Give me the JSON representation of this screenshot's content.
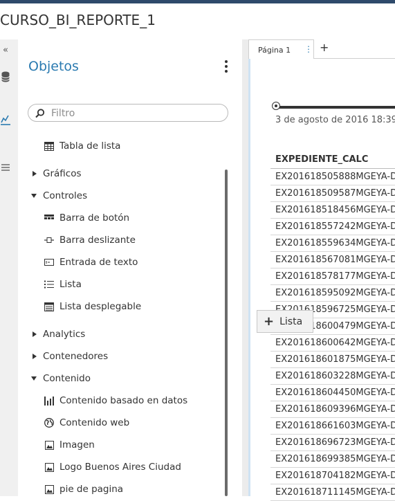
{
  "report": {
    "title": "CURSO_BI_REPORTE_1"
  },
  "rail": {
    "collapse_glyph": "«",
    "icons": [
      "database-icon",
      "chart-icon",
      "list-icon"
    ]
  },
  "objects_panel": {
    "title": "Objetos",
    "filter_placeholder": "Filtro",
    "top_item": {
      "label": "Tabla de lista",
      "icon": "table-icon"
    },
    "groups": [
      {
        "label": "Gráficos",
        "expanded": false
      },
      {
        "label": "Controles",
        "expanded": true,
        "items": [
          {
            "label": "Barra de botón",
            "icon": "button-bar-icon"
          },
          {
            "label": "Barra deslizante",
            "icon": "slider-icon"
          },
          {
            "label": "Entrada de texto",
            "icon": "text-input-icon"
          },
          {
            "label": "Lista",
            "icon": "list-icon"
          },
          {
            "label": "Lista desplegable",
            "icon": "dropdown-list-icon"
          }
        ]
      },
      {
        "label": "Analytics",
        "expanded": false
      },
      {
        "label": "Contenedores",
        "expanded": false
      },
      {
        "label": "Contenido",
        "expanded": true,
        "items": [
          {
            "label": "Contenido basado en datos",
            "icon": "data-driven-content-icon"
          },
          {
            "label": "Contenido web",
            "icon": "globe-icon"
          },
          {
            "label": "Imagen",
            "icon": "image-icon"
          },
          {
            "label": "Logo Buenos Aires Ciudad",
            "icon": "image-icon"
          },
          {
            "label": "pie de pagina",
            "icon": "image-icon"
          }
        ]
      }
    ]
  },
  "canvas": {
    "tab_label": "Página 1",
    "tab_menu_glyph": "⋮",
    "add_tab_glyph": "+",
    "slider_label": "3 de agosto de 2016 18:39",
    "table": {
      "header": "EXPEDIENTE_CALC",
      "rows": [
        "EX201618505888MGEYA-D",
        "EX201618509587MGEYA-D",
        "EX201618518456MGEYA-D",
        "EX201618557242MGEYA-D",
        "EX201618559634MGEYA-D",
        "EX201618567081MGEYA-D",
        "EX201618578177MGEYA-D",
        "EX201618595092MGEYA-D",
        "EX201618596725MGEYA-D",
        "EX201618600479MGEYA-D",
        "EX201618600642MGEYA-D",
        "EX201618601875MGEYA-D",
        "EX201618603228MGEYA-D",
        "EX201618604450MGEYA-D",
        "EX201618609396MGEYA-D",
        "EX201618661603MGEYA-D",
        "EX201618696723MGEYA-D",
        "EX201618699385MGEYA-D",
        "EX201618704182MGEYA-D",
        "EX201618711145MGEYA-D"
      ]
    }
  },
  "drag_chip": {
    "plus": "+",
    "label": "Lista"
  },
  "colors": {
    "accent": "#2a7ab0",
    "topbar": "#2f4a6b"
  }
}
